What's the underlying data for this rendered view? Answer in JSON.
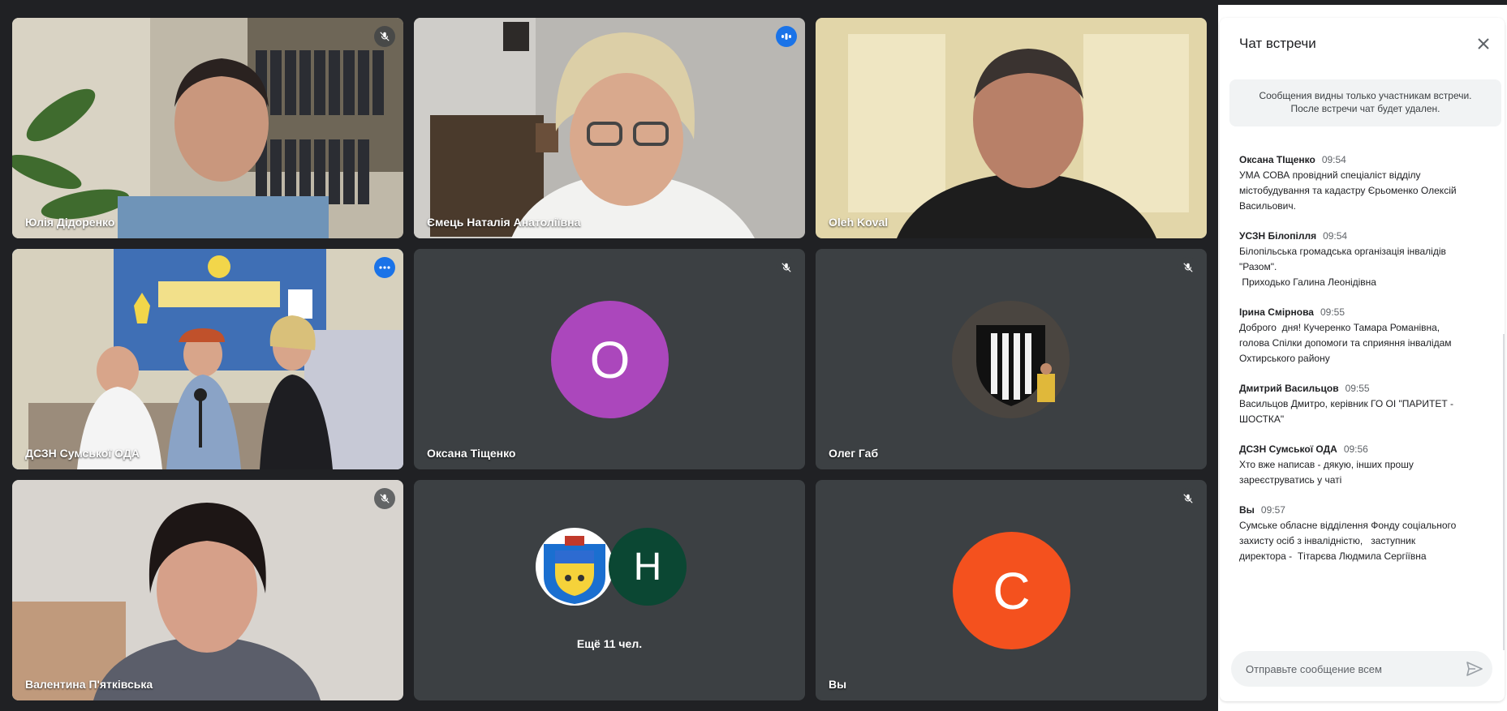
{
  "tiles": [
    {
      "name": "Юлія Дідоренко"
    },
    {
      "name": "Ємець Наталія Анатоліївна"
    },
    {
      "name": "Oleh Koval"
    },
    {
      "name": "ДСЗН Сумської ОДА"
    },
    {
      "name": "Оксана Тіщенко",
      "initial": "O",
      "color": "#ab47bc"
    },
    {
      "name": "Олег Габ"
    },
    {
      "name": "Валентина П'ятківська"
    },
    {
      "name": "",
      "initial": "H",
      "color": "#0b4733",
      "more": "Ещё 11 чел."
    },
    {
      "name": "Вы",
      "initial": "C",
      "color": "#f4511e"
    }
  ],
  "chat": {
    "title": "Чат встречи",
    "notice_line1": "Сообщения видны только участникам встречи.",
    "notice_line2": "После встречи чат будет удален.",
    "messages": [
      {
        "sender": "Оксана ТІщенко",
        "time": "09:54",
        "text": "УМА СОВА провідний спеціаліст відділу\nмістобудування та кадастру Єрьоменко Олексій\nВасильович."
      },
      {
        "sender": "УСЗН Білопілля",
        "time": "09:54",
        "text": "Білопільська громадська організація інвалідів\n\"Разом\".\n Приходько Галина Леонідівна"
      },
      {
        "sender": "Ірина Смірнова",
        "time": "09:55",
        "text": "Доброго  дня! Кучеренко Тамара Романівна,\nголова Спілки допомоги та сприяння інвалідам\nОхтирського району"
      },
      {
        "sender": "Дмитрий Васильцов",
        "time": "09:55",
        "text": "Васильцов Дмитро, керівник ГО ОІ \"ПАРИТЕТ -\nШОСТКА\""
      },
      {
        "sender": "ДСЗН Сумської ОДА",
        "time": "09:56",
        "text": "Хто вже написав - дякую, інших прошу\nзареєструватись у чаті"
      },
      {
        "sender": "Вы",
        "time": "09:57",
        "text": "Сумське обласне відділення Фонду соціального\nзахисту осіб з інвалідністю,   заступник\nдиректора -  Тітарєва Людмила Сергіївна"
      }
    ],
    "input_placeholder": "Отправьте сообщение всем"
  }
}
